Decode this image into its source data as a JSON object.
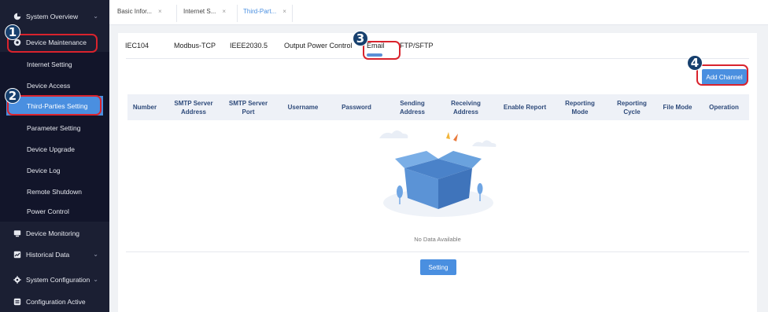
{
  "sidebar": {
    "top_items": [
      {
        "label": "System Overview",
        "icon": "pie-chart-icon",
        "chevron": true
      },
      {
        "label": "Device Maintenance",
        "icon": "wrench-icon",
        "chevron": false
      }
    ],
    "sub_items": [
      {
        "label": "Internet Setting"
      },
      {
        "label": "Device Access"
      },
      {
        "label": "Third-Parties Setting",
        "active": true
      },
      {
        "label": "Parameter Setting"
      },
      {
        "label": "Device Upgrade"
      },
      {
        "label": "Device Log"
      },
      {
        "label": "Remote Shutdown"
      },
      {
        "label": "Power Control"
      }
    ],
    "bottom_items": [
      {
        "label": "Device Monitoring",
        "icon": "monitor-icon",
        "chevron": false
      },
      {
        "label": "Historical Data",
        "icon": "chart-icon",
        "chevron": true
      },
      {
        "label": "System Configuration",
        "icon": "gear-icon",
        "chevron": true
      },
      {
        "label": "Configuration Active",
        "icon": "list-icon",
        "chevron": false
      }
    ]
  },
  "tabs": [
    {
      "label": "Basic Infor...",
      "close": "×"
    },
    {
      "label": "Internet S...",
      "close": "×"
    },
    {
      "label": "Third-Part...",
      "close": "×",
      "active": true
    }
  ],
  "protocols": [
    "IEC104",
    "Modbus-TCP",
    "IEEE2030.5",
    "Output Power Control",
    "Email",
    "FTP/SFTP"
  ],
  "active_protocol": "Email",
  "add_button": "Add Channel",
  "table_headers": [
    [
      "Number"
    ],
    [
      "SMTP Server",
      "Address"
    ],
    [
      "SMTP Server",
      "Port"
    ],
    [
      "Username"
    ],
    [
      "Password"
    ],
    [
      "Sending",
      "Address"
    ],
    [
      "Receiving",
      "Address"
    ],
    [
      "Enable Report"
    ],
    [
      "Reporting",
      "Mode"
    ],
    [
      "Reporting",
      "Cycle"
    ],
    [
      "File Mode"
    ],
    [
      "Operation"
    ]
  ],
  "empty_text": "No Data Available",
  "setting_button": "Setting",
  "annotations": [
    "1",
    "2",
    "3",
    "4"
  ],
  "colors": {
    "sidebar_bg": "#1b1f33",
    "accent": "#4a8fe0",
    "annotation_red": "#d9232d",
    "badge_navy": "#17406e"
  }
}
